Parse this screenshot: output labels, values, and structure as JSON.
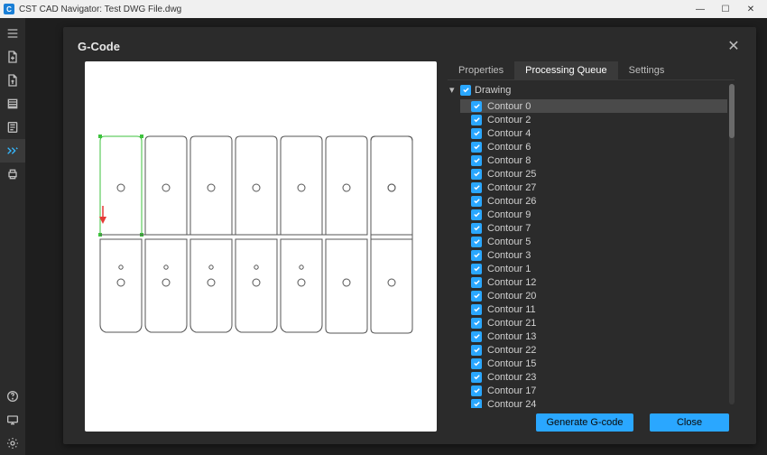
{
  "app": {
    "title": "CST CAD Navigator: Test DWG File.dwg",
    "icon_initial": "C"
  },
  "win_controls": {
    "min": "—",
    "max": "☐",
    "close": "✕"
  },
  "sidebar": {
    "tools": [
      {
        "name": "menu-icon"
      },
      {
        "name": "new-file-icon"
      },
      {
        "name": "open-file-icon"
      },
      {
        "name": "layers-icon"
      },
      {
        "name": "properties-icon"
      },
      {
        "name": "gcode-icon",
        "active": true
      },
      {
        "name": "print-icon"
      }
    ],
    "bottom_tools": [
      {
        "name": "help-icon"
      },
      {
        "name": "monitor-icon"
      },
      {
        "name": "settings-icon"
      }
    ]
  },
  "dialog": {
    "title": "G-Code",
    "tabs": [
      {
        "label": "Properties",
        "active": false
      },
      {
        "label": "Processing Queue",
        "active": true
      },
      {
        "label": "Settings",
        "active": false
      }
    ],
    "tree": {
      "root_label": "Drawing",
      "items": [
        "Contour 0",
        "Contour 2",
        "Contour 4",
        "Contour 6",
        "Contour 8",
        "Contour 25",
        "Contour 27",
        "Contour 26",
        "Contour 9",
        "Contour 7",
        "Contour 5",
        "Contour 3",
        "Contour 1",
        "Contour 12",
        "Contour 20",
        "Contour 11",
        "Contour 21",
        "Contour 13",
        "Contour 22",
        "Contour 15",
        "Contour 23",
        "Contour 17",
        "Contour 24"
      ],
      "selected_index": 0
    },
    "buttons": {
      "generate": "Generate G-code",
      "close": "Close"
    }
  }
}
